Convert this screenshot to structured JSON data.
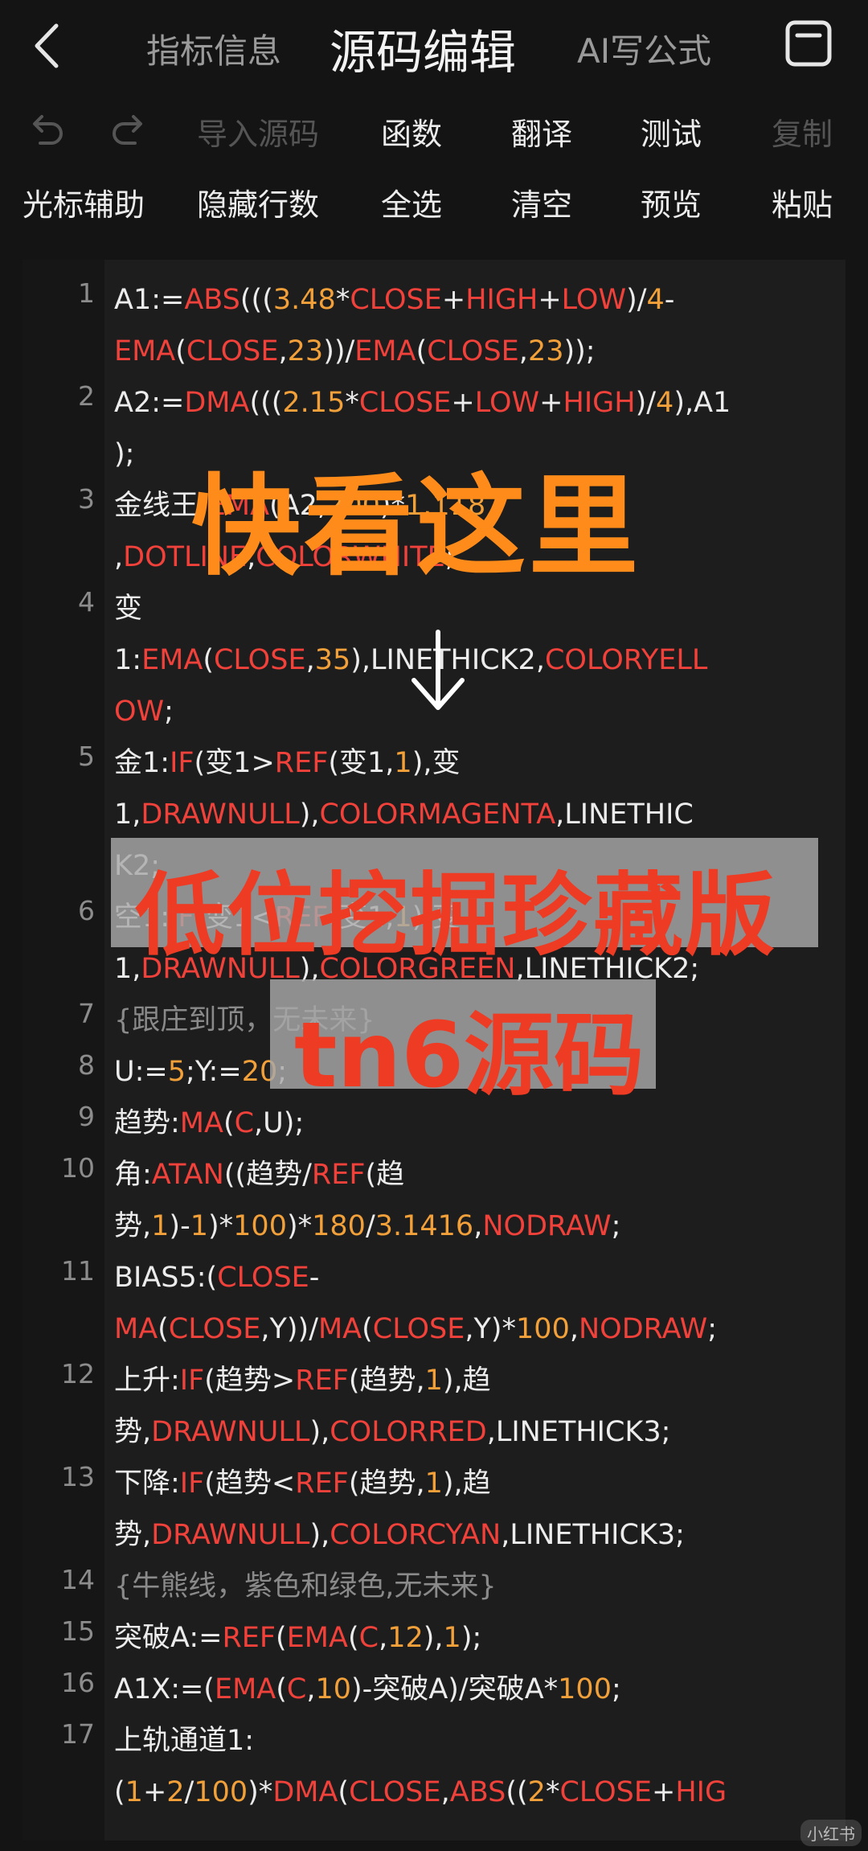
{
  "header": {
    "tabs": [
      {
        "label": "指标信息"
      },
      {
        "label": "源码编辑"
      },
      {
        "label": "AI写公式"
      }
    ]
  },
  "toolbar1": {
    "undo_icon": "undo-icon",
    "redo_icon": "redo-icon",
    "items": [
      {
        "label": "导入源码"
      },
      {
        "label": "函数"
      },
      {
        "label": "翻译"
      },
      {
        "label": "测试"
      },
      {
        "label": "复制"
      }
    ]
  },
  "toolbar2": {
    "items": [
      {
        "label": "光标辅助"
      },
      {
        "label": "隐藏行数"
      },
      {
        "label": "全选"
      },
      {
        "label": "清空"
      },
      {
        "label": "预览"
      },
      {
        "label": "粘贴"
      }
    ]
  },
  "line_numbers": [
    "1",
    "2",
    "3",
    "4",
    "5",
    "6",
    "7",
    "8",
    "9",
    "10",
    "11",
    "12",
    "13",
    "14",
    "15",
    "16",
    "17"
  ],
  "code_lines": [
    [
      [
        "A1:=",
        ""
      ],
      [
        "ABS",
        "k"
      ],
      [
        "(((",
        ""
      ],
      [
        "3.48",
        "n"
      ],
      [
        "*",
        ""
      ],
      [
        "CLOSE",
        "k"
      ],
      [
        "+",
        ""
      ],
      [
        "HIGH",
        "k"
      ],
      [
        "+",
        ""
      ],
      [
        "LOW",
        "k"
      ],
      [
        ")/",
        ""
      ],
      [
        "4",
        "n"
      ],
      [
        "-",
        ""
      ]
    ],
    [
      [
        "EMA",
        "k"
      ],
      [
        "(",
        ""
      ],
      [
        "CLOSE",
        "k"
      ],
      [
        ",",
        ""
      ],
      [
        "23",
        "n"
      ],
      [
        "))/",
        ""
      ],
      [
        "EMA",
        "k"
      ],
      [
        "(",
        ""
      ],
      [
        "CLOSE",
        "k"
      ],
      [
        ",",
        ""
      ],
      [
        "23",
        "n"
      ],
      [
        "));",
        ""
      ]
    ],
    [
      [
        "A2:=",
        ""
      ],
      [
        "DMA",
        "k"
      ],
      [
        "(((",
        ""
      ],
      [
        "2.15",
        "n"
      ],
      [
        "*",
        ""
      ],
      [
        "CLOSE",
        "k"
      ],
      [
        "+",
        ""
      ],
      [
        "LOW",
        "k"
      ],
      [
        "+",
        ""
      ],
      [
        "HIGH",
        "k"
      ],
      [
        ")/",
        ""
      ],
      [
        "4",
        "n"
      ],
      [
        "),A1",
        ""
      ]
    ],
    [
      [
        ");",
        ""
      ]
    ],
    [
      [
        "金线王:",
        ""
      ],
      [
        "EMA",
        "k"
      ],
      [
        "(A2,",
        ""
      ],
      [
        "200",
        "n"
      ],
      [
        ")*",
        ""
      ],
      [
        "1.118",
        "n"
      ]
    ],
    [
      [
        ",",
        ""
      ],
      [
        "DOTLINE",
        "k"
      ],
      [
        ",",
        ""
      ],
      [
        "COLORWHITE",
        "k"
      ],
      [
        ";",
        ""
      ]
    ],
    [
      [
        "变",
        ""
      ]
    ],
    [
      [
        "1:",
        ""
      ],
      [
        "EMA",
        "k"
      ],
      [
        "(",
        ""
      ],
      [
        "CLOSE",
        "k"
      ],
      [
        ",",
        ""
      ],
      [
        "35",
        "n"
      ],
      [
        "),LINETHICK2,",
        ""
      ],
      [
        "COLORYELL",
        "k"
      ]
    ],
    [
      [
        "OW",
        "k"
      ],
      [
        ";",
        ""
      ]
    ],
    [
      [
        "金1:",
        ""
      ],
      [
        "IF",
        "k"
      ],
      [
        "(变1>",
        ""
      ],
      [
        "REF",
        "k"
      ],
      [
        "(变1,",
        ""
      ],
      [
        "1",
        "n"
      ],
      [
        "),变",
        ""
      ]
    ],
    [
      [
        "1,",
        ""
      ],
      [
        "DRAWNULL",
        "k"
      ],
      [
        "),",
        ""
      ],
      [
        "COLORMAGENTA",
        "k"
      ],
      [
        ",LINETHIC",
        ""
      ]
    ],
    [
      [
        "K2;",
        ""
      ]
    ],
    [
      [
        "空1:",
        ""
      ],
      [
        "IF",
        "k"
      ],
      [
        "(变1<",
        ""
      ],
      [
        "REF",
        "k"
      ],
      [
        "(变1,",
        ""
      ],
      [
        "1",
        "n"
      ],
      [
        "),变",
        ""
      ]
    ],
    [
      [
        "1,",
        ""
      ],
      [
        "DRAWNULL",
        "k"
      ],
      [
        "),",
        ""
      ],
      [
        "COLORGREEN",
        "k"
      ],
      [
        ",LINETHICK2;",
        ""
      ]
    ],
    [
      [
        "{跟庄到顶，无未来}",
        "c"
      ]
    ],
    [
      [
        "U:=",
        ""
      ],
      [
        "5",
        "n"
      ],
      [
        ";Y:=",
        ""
      ],
      [
        "20",
        "n"
      ],
      [
        ";",
        ""
      ]
    ],
    [
      [
        "趋势:",
        ""
      ],
      [
        "MA",
        "k"
      ],
      [
        "(",
        ""
      ],
      [
        "C",
        "k"
      ],
      [
        ",U);",
        ""
      ]
    ],
    [
      [
        "角:",
        ""
      ],
      [
        "ATAN",
        "k"
      ],
      [
        "((趋势/",
        ""
      ],
      [
        "REF",
        "k"
      ],
      [
        "(趋",
        ""
      ]
    ],
    [
      [
        "势,",
        ""
      ],
      [
        "1",
        "n"
      ],
      [
        ")-",
        ""
      ],
      [
        "1",
        "n"
      ],
      [
        ")*",
        ""
      ],
      [
        "100",
        "n"
      ],
      [
        ")*",
        ""
      ],
      [
        "180",
        "n"
      ],
      [
        "/",
        ""
      ],
      [
        "3.1416",
        "n"
      ],
      [
        ",",
        ""
      ],
      [
        "NODRAW",
        "k"
      ],
      [
        ";",
        ""
      ]
    ],
    [
      [
        "BIAS5:(",
        ""
      ],
      [
        "CLOSE",
        "k"
      ],
      [
        "-",
        ""
      ]
    ],
    [
      [
        "MA",
        "k"
      ],
      [
        "(",
        ""
      ],
      [
        "CLOSE",
        "k"
      ],
      [
        ",Y))/",
        ""
      ],
      [
        "MA",
        "k"
      ],
      [
        "(",
        ""
      ],
      [
        "CLOSE",
        "k"
      ],
      [
        ",Y)*",
        ""
      ],
      [
        "100",
        "n"
      ],
      [
        ",",
        ""
      ],
      [
        "NODRAW",
        "k"
      ],
      [
        ";",
        ""
      ]
    ],
    [
      [
        "上升:",
        ""
      ],
      [
        "IF",
        "k"
      ],
      [
        "(趋势>",
        ""
      ],
      [
        "REF",
        "k"
      ],
      [
        "(趋势,",
        ""
      ],
      [
        "1",
        "n"
      ],
      [
        "),趋",
        ""
      ]
    ],
    [
      [
        "势,",
        ""
      ],
      [
        "DRAWNULL",
        "k"
      ],
      [
        "),",
        ""
      ],
      [
        "COLORRED",
        "k"
      ],
      [
        ",LINETHICK3;",
        ""
      ]
    ],
    [
      [
        "下降:",
        ""
      ],
      [
        "IF",
        "k"
      ],
      [
        "(趋势<",
        ""
      ],
      [
        "REF",
        "k"
      ],
      [
        "(趋势,",
        ""
      ],
      [
        "1",
        "n"
      ],
      [
        "),趋",
        ""
      ]
    ],
    [
      [
        "势,",
        ""
      ],
      [
        "DRAWNULL",
        "k"
      ],
      [
        "),",
        ""
      ],
      [
        "COLORCYAN",
        "k"
      ],
      [
        ",LINETHICK3;",
        ""
      ]
    ],
    [
      [
        "{牛熊线，紫色和绿色,无未来}",
        "c"
      ]
    ],
    [
      [
        "突破A:=",
        ""
      ],
      [
        "REF",
        "k"
      ],
      [
        "(",
        ""
      ],
      [
        "EMA",
        "k"
      ],
      [
        "(",
        ""
      ],
      [
        "C",
        "k"
      ],
      [
        ",",
        ""
      ],
      [
        "12",
        "n"
      ],
      [
        "),",
        ""
      ],
      [
        "1",
        "n"
      ],
      [
        ");",
        ""
      ]
    ],
    [
      [
        "A1X:=(",
        ""
      ],
      [
        "EMA",
        "k"
      ],
      [
        "(",
        ""
      ],
      [
        "C",
        "k"
      ],
      [
        ",",
        ""
      ],
      [
        "10",
        "n"
      ],
      [
        ")-突破A)/突破A*",
        ""
      ],
      [
        "100",
        "n"
      ],
      [
        ";",
        ""
      ]
    ],
    [
      [
        "上轨通道1:",
        ""
      ]
    ],
    [
      [
        "(",
        ""
      ],
      [
        "1",
        "n"
      ],
      [
        "+",
        ""
      ],
      [
        "2",
        "n"
      ],
      [
        "/",
        ""
      ],
      [
        "100",
        "n"
      ],
      [
        ")*",
        ""
      ],
      [
        "DMA",
        "k"
      ],
      [
        "(",
        ""
      ],
      [
        "CLOSE",
        "k"
      ],
      [
        ",",
        ""
      ],
      [
        "ABS",
        "k"
      ],
      [
        "((",
        ""
      ],
      [
        "2",
        "n"
      ],
      [
        "*",
        ""
      ],
      [
        "CLOSE",
        "k"
      ],
      [
        "+",
        ""
      ],
      [
        "HIG",
        "k"
      ]
    ]
  ],
  "overlay": {
    "headline": "快看这里",
    "banner": "低位挖掘珍藏版",
    "tag": "tn6源码",
    "watermark": "小红书"
  },
  "colors": {
    "background": "#141414",
    "keyword": "#f0413a",
    "number": "#f2a03a",
    "comment": "#8a8a8a",
    "headline": "#ff8c1a",
    "banner_text": "#ee3b24"
  }
}
